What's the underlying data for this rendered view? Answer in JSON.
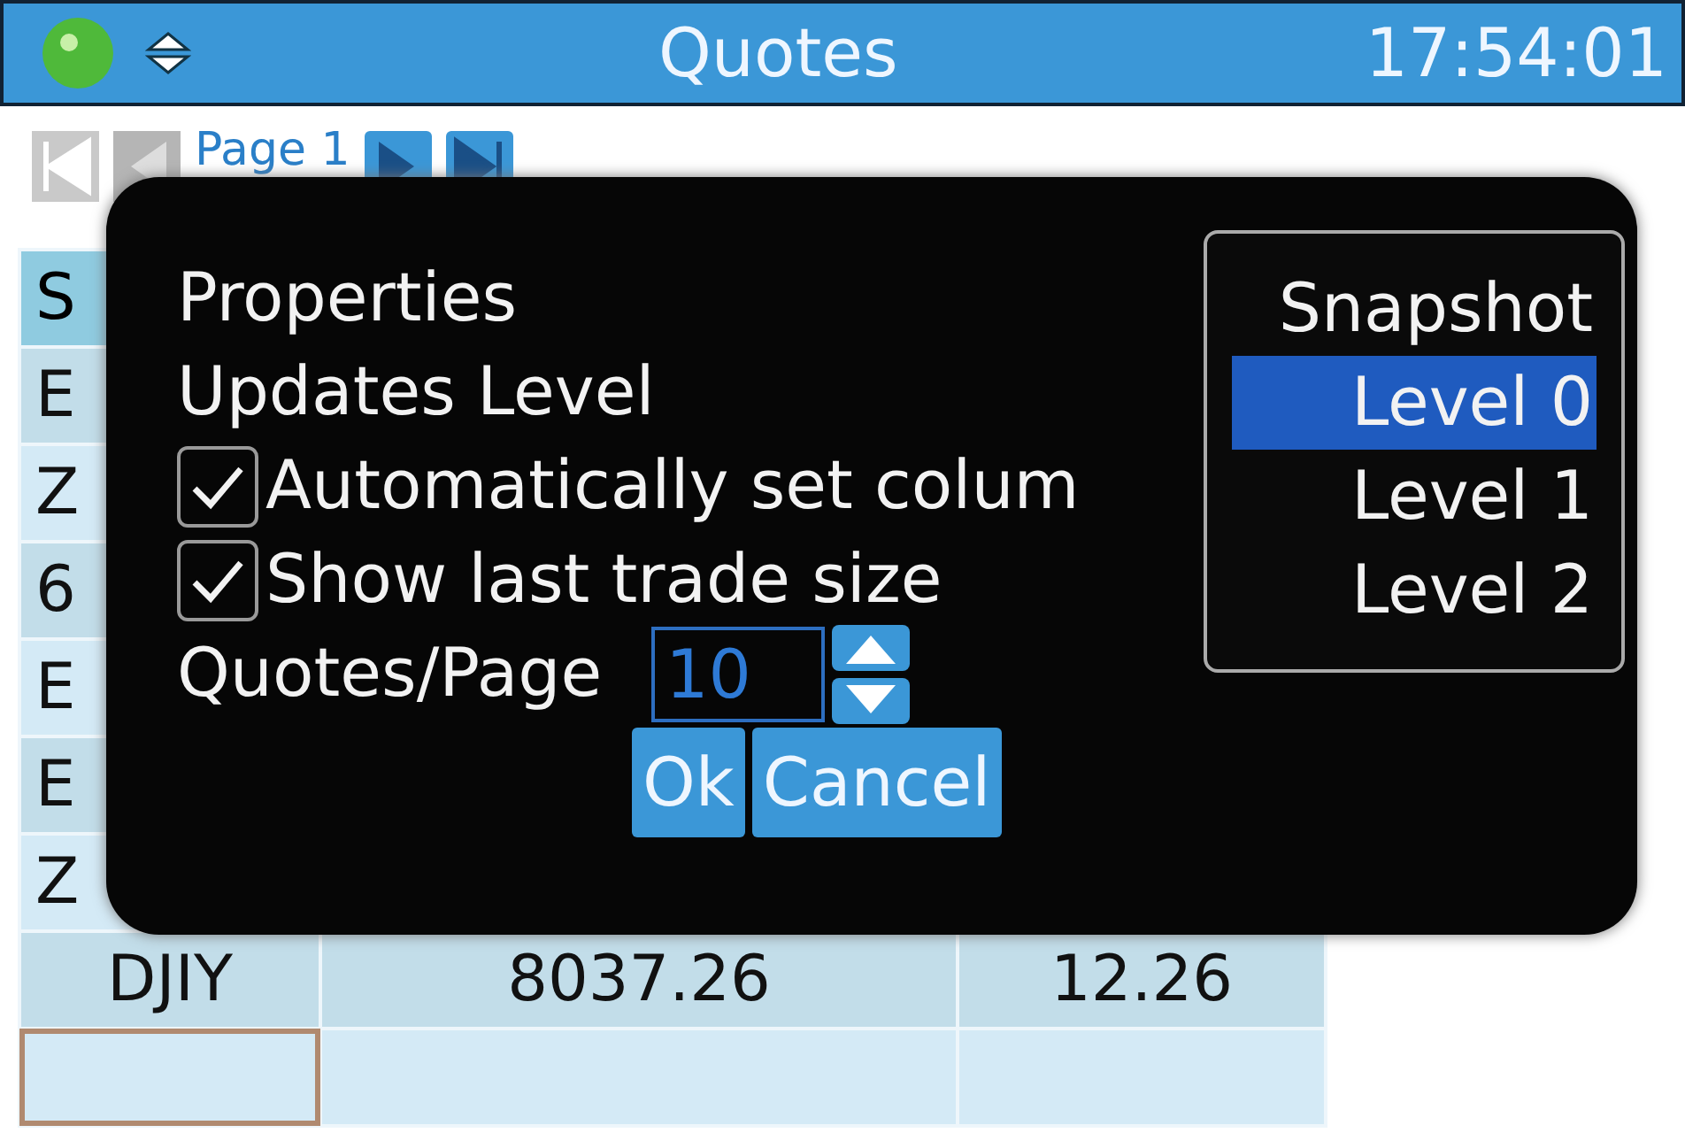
{
  "status_bar": {
    "title": "Quotes",
    "time": "17:54:01"
  },
  "pager": {
    "page": "Page 1"
  },
  "table": {
    "header": "S",
    "rows": [
      {
        "cells": [
          "E"
        ]
      },
      {
        "cells": [
          "Z"
        ]
      },
      {
        "cells": [
          "6"
        ]
      },
      {
        "cells": [
          "E"
        ]
      },
      {
        "cells": [
          "E"
        ]
      },
      {
        "cells": [
          "Z"
        ]
      },
      {
        "cells": [
          "DJIY",
          "8037.26",
          "12.26"
        ]
      }
    ],
    "blank_row": {
      "focused": true
    }
  },
  "dialog": {
    "title": "Properties",
    "updates_label": "Updates Level",
    "checkboxes": [
      {
        "label": "Automatically set colum",
        "checked": true
      },
      {
        "label": "Show last trade size",
        "checked": true
      }
    ],
    "quotes_per_page": {
      "label": "Quotes/Page",
      "value": "10"
    },
    "buttons": [
      "Ok",
      "Cancel"
    ]
  },
  "dropdown": {
    "items": [
      {
        "label": "Snapshot",
        "selected": false
      },
      {
        "label": "Level 0",
        "selected": true
      },
      {
        "label": "Level 1",
        "selected": false
      },
      {
        "label": "Level 2",
        "selected": false
      }
    ]
  }
}
